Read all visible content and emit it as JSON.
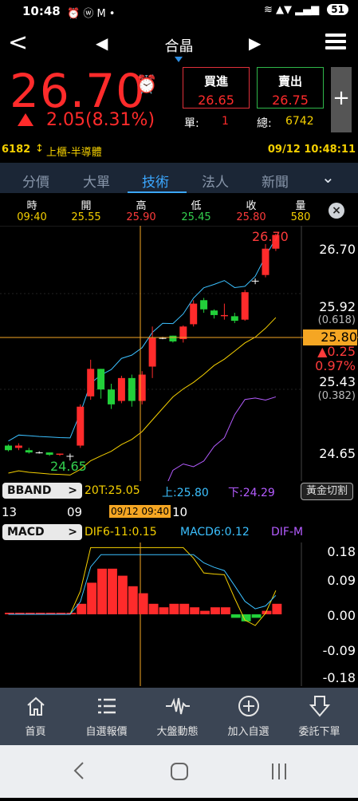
{
  "status": {
    "time": "10:48",
    "icons": "⏰ ⓦ M •",
    "battery": "51"
  },
  "header": {
    "title": "合晶",
    "back": "<",
    "prev": "◀",
    "next": "▶"
  },
  "quote": {
    "price": "26.70",
    "change": "2.05",
    "change_pct": "(8.31%)",
    "buy_label": "買進",
    "buy_value": "26.65",
    "sell_label": "賣出",
    "sell_value": "26.75",
    "single_label": "單:",
    "single_value": "1",
    "total_label": "總:",
    "total_value": "6742",
    "plus": "+"
  },
  "info": {
    "code": "6182",
    "market": "上櫃-半導體",
    "datetime": "09/12 10:48:11"
  },
  "tabs": [
    "分價",
    "大單",
    "技術",
    "法人",
    "新聞"
  ],
  "ohlc": {
    "labels": [
      "時",
      "開",
      "高",
      "低",
      "收",
      "量"
    ],
    "values": [
      "09:40",
      "25.55",
      "25.90",
      "25.45",
      "25.80",
      "580"
    ],
    "close_icon": "×"
  },
  "chart_data": {
    "type": "candlestick",
    "y_labels": [
      "26.70",
      "25.92",
      "(0.618)",
      "25.80",
      "▲0.25",
      "0.97%",
      "25.43",
      "(0.382)",
      "24.65"
    ],
    "high_label": "26.70",
    "low_label": "24.65",
    "candles": [
      {
        "o": 24.86,
        "c": 24.82,
        "h": 24.87,
        "l": 24.81
      },
      {
        "o": 24.84,
        "c": 24.86,
        "h": 24.88,
        "l": 24.82
      },
      {
        "o": 24.82,
        "c": 24.8,
        "h": 24.84,
        "l": 24.79
      },
      {
        "o": 24.8,
        "c": 24.8,
        "h": 24.81,
        "l": 24.79
      },
      {
        "o": 24.8,
        "c": 24.78,
        "h": 24.8,
        "l": 24.77
      },
      {
        "o": 24.78,
        "c": 24.79,
        "h": 24.79,
        "l": 24.77
      },
      {
        "o": 24.77,
        "c": 24.77,
        "h": 24.79,
        "l": 24.73
      },
      {
        "o": 24.86,
        "c": 25.2,
        "h": 25.22,
        "l": 24.84
      },
      {
        "o": 25.29,
        "c": 25.53,
        "h": 25.61,
        "l": 25.26
      },
      {
        "o": 25.53,
        "c": 25.35,
        "h": 25.53,
        "l": 25.27
      },
      {
        "o": 25.35,
        "c": 25.22,
        "h": 25.4,
        "l": 25.18
      },
      {
        "o": 25.25,
        "c": 25.45,
        "h": 25.47,
        "l": 25.23
      },
      {
        "o": 25.45,
        "c": 25.25,
        "h": 25.48,
        "l": 25.2
      },
      {
        "o": 25.25,
        "c": 25.48,
        "h": 25.51,
        "l": 25.22
      },
      {
        "o": 25.55,
        "c": 25.8,
        "h": 25.9,
        "l": 25.45
      },
      {
        "o": 25.8,
        "c": 25.8,
        "h": 25.81,
        "l": 25.79
      },
      {
        "o": 25.82,
        "c": 25.77,
        "h": 25.82,
        "l": 25.76
      },
      {
        "o": 25.79,
        "c": 25.9,
        "h": 25.91,
        "l": 25.76
      },
      {
        "o": 25.92,
        "c": 26.1,
        "h": 26.13,
        "l": 25.9
      },
      {
        "o": 26.13,
        "c": 26.05,
        "h": 26.15,
        "l": 26.02
      },
      {
        "o": 26.04,
        "c": 26.0,
        "h": 26.05,
        "l": 25.97
      },
      {
        "o": 25.99,
        "c": 26.0,
        "h": 26.1,
        "l": 25.96
      },
      {
        "o": 25.99,
        "c": 25.95,
        "h": 26.02,
        "l": 25.93
      },
      {
        "o": 25.96,
        "c": 26.2,
        "h": 26.22,
        "l": 25.95
      },
      {
        "o": 26.3,
        "c": 26.3,
        "h": 26.32,
        "l": 26.27
      },
      {
        "o": 26.35,
        "c": 26.58,
        "h": 26.62,
        "l": 26.33
      },
      {
        "o": 26.58,
        "c": 26.7,
        "h": 26.71,
        "l": 26.56
      }
    ],
    "ylim": [
      24.55,
      26.78
    ]
  },
  "bband": {
    "label": "BBAND",
    "mid": "20T:25.05",
    "up": "上:25.80",
    "down": "下:24.29",
    "golden": "黃金切割"
  },
  "xaxis": {
    "t1": "13",
    "t2": "09",
    "cursor": "09/12 09:40",
    "t3": "10"
  },
  "macd": {
    "label": "MACD",
    "dif": "DIF6-11:0.15",
    "macd": "MACD6:0.12",
    "difm": "DIF-M",
    "y_labels": [
      "0.18",
      "0.09",
      "0.00",
      "-0.09",
      "-0.18"
    ],
    "hist": [
      0.0,
      0.0,
      0.0,
      0.0,
      0.0,
      0.0,
      0.0,
      0.03,
      0.09,
      0.13,
      0.13,
      0.11,
      0.08,
      0.06,
      0.03,
      0.02,
      0.03,
      0.03,
      0.02,
      0.01,
      0.02,
      0.02,
      -0.01,
      -0.02,
      -0.01,
      0.01,
      0.03
    ]
  },
  "nav": [
    {
      "label": "首頁",
      "icon": "home-icon"
    },
    {
      "label": "自選報價",
      "icon": "list-icon"
    },
    {
      "label": "大盤動態",
      "icon": "pulse-icon"
    },
    {
      "label": "加入自選",
      "icon": "add-circle-icon"
    },
    {
      "label": "委託下單",
      "icon": "order-icon"
    }
  ]
}
